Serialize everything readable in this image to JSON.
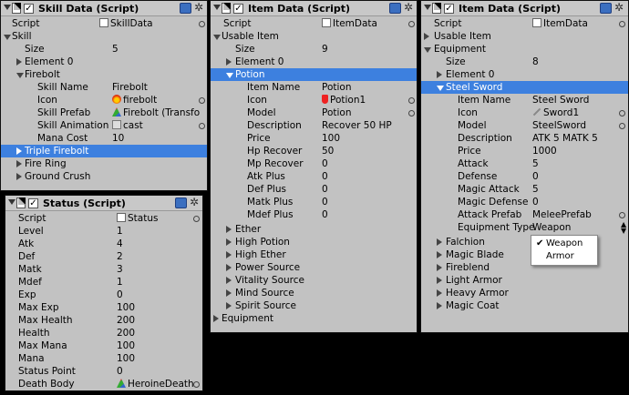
{
  "skill_panel": {
    "title": "Skill Data (Script)",
    "script_label": "Script",
    "script_value": "SkillData",
    "skill_label": "Skill",
    "size_label": "Size",
    "size_value": "5",
    "element0": "Element 0",
    "firebolt": "Firebolt",
    "skill_name_label": "Skill Name",
    "skill_name_value": "Firebolt",
    "icon_label": "Icon",
    "icon_value": "firebolt",
    "prefab_label": "Skill Prefab",
    "prefab_value": "Firebolt (Transfo",
    "anim_label": "Skill Animation",
    "anim_value": "cast",
    "mana_label": "Mana Cost",
    "mana_value": "10",
    "items": [
      "Triple Firebolt",
      "Fire Ring",
      "Ground Crush"
    ]
  },
  "status_panel": {
    "title": "Status (Script)",
    "script_label": "Script",
    "script_value": "Status",
    "fields": [
      {
        "label": "Level",
        "value": "1"
      },
      {
        "label": "Atk",
        "value": "4"
      },
      {
        "label": "Def",
        "value": "2"
      },
      {
        "label": "Matk",
        "value": "3"
      },
      {
        "label": "Mdef",
        "value": "1"
      },
      {
        "label": "Exp",
        "value": "0"
      },
      {
        "label": "Max Exp",
        "value": "100"
      },
      {
        "label": "Max Health",
        "value": "200"
      },
      {
        "label": "Health",
        "value": "200"
      },
      {
        "label": "Max Mana",
        "value": "100"
      },
      {
        "label": "Mana",
        "value": "100"
      },
      {
        "label": "Status Point",
        "value": "0"
      }
    ],
    "death_label": "Death Body",
    "death_value": "HeroineDeath"
  },
  "item_panel": {
    "title": "Item Data (Script)",
    "script_label": "Script",
    "script_value": "ItemData",
    "usable_label": "Usable Item",
    "size_label": "Size",
    "size_value": "9",
    "element0": "Element 0",
    "potion": "Potion",
    "fields": [
      {
        "label": "Item Name",
        "value": "Potion"
      },
      {
        "label": "Icon",
        "value": "Potion1"
      },
      {
        "label": "Model",
        "value": "Potion"
      },
      {
        "label": "Description",
        "value": "Recover 50 HP"
      },
      {
        "label": "Price",
        "value": "100"
      },
      {
        "label": "Hp Recover",
        "value": "50"
      },
      {
        "label": "Mp Recover",
        "value": "0"
      },
      {
        "label": "Atk Plus",
        "value": "0"
      },
      {
        "label": "Def Plus",
        "value": "0"
      },
      {
        "label": "Matk Plus",
        "value": "0"
      },
      {
        "label": "Mdef Plus",
        "value": "0"
      }
    ],
    "items": [
      "Ether",
      "High Potion",
      "High Ether",
      "Power Source",
      "Vitality Source",
      "Mind Source",
      "Spirit Source"
    ],
    "equipment_label": "Equipment"
  },
  "equip_panel": {
    "title": "Item Data (Script)",
    "script_label": "Script",
    "script_value": "ItemData",
    "usable_label": "Usable Item",
    "equipment_label": "Equipment",
    "size_label": "Size",
    "size_value": "8",
    "element0": "Element 0",
    "steel_sword": "Steel Sword",
    "fields": [
      {
        "label": "Item Name",
        "value": "Steel Sword"
      },
      {
        "label": "Icon",
        "value": "Sword1"
      },
      {
        "label": "Model",
        "value": "SteelSword"
      },
      {
        "label": "Description",
        "value": "ATK 5 MATK 5"
      },
      {
        "label": "Price",
        "value": "1000"
      },
      {
        "label": "Attack",
        "value": "5"
      },
      {
        "label": "Defense",
        "value": "0"
      },
      {
        "label": "Magic Attack",
        "value": "5"
      },
      {
        "label": "Magic Defense",
        "value": "0"
      },
      {
        "label": "Attack Prefab",
        "value": "MeleePrefab"
      },
      {
        "label": "Equipment Type",
        "value": "Weapon"
      }
    ],
    "items": [
      "Falchion",
      "Magic Blade",
      "Fireblend",
      "Light Armor",
      "Heavy Armor",
      "Magic Coat"
    ],
    "dropdown_options": [
      "Weapon",
      "Armor"
    ],
    "dropdown_checked": "✔"
  },
  "colors": {
    "selection": "#3d80df",
    "panel_bg": "#c2c2c2",
    "background": "#000000"
  }
}
